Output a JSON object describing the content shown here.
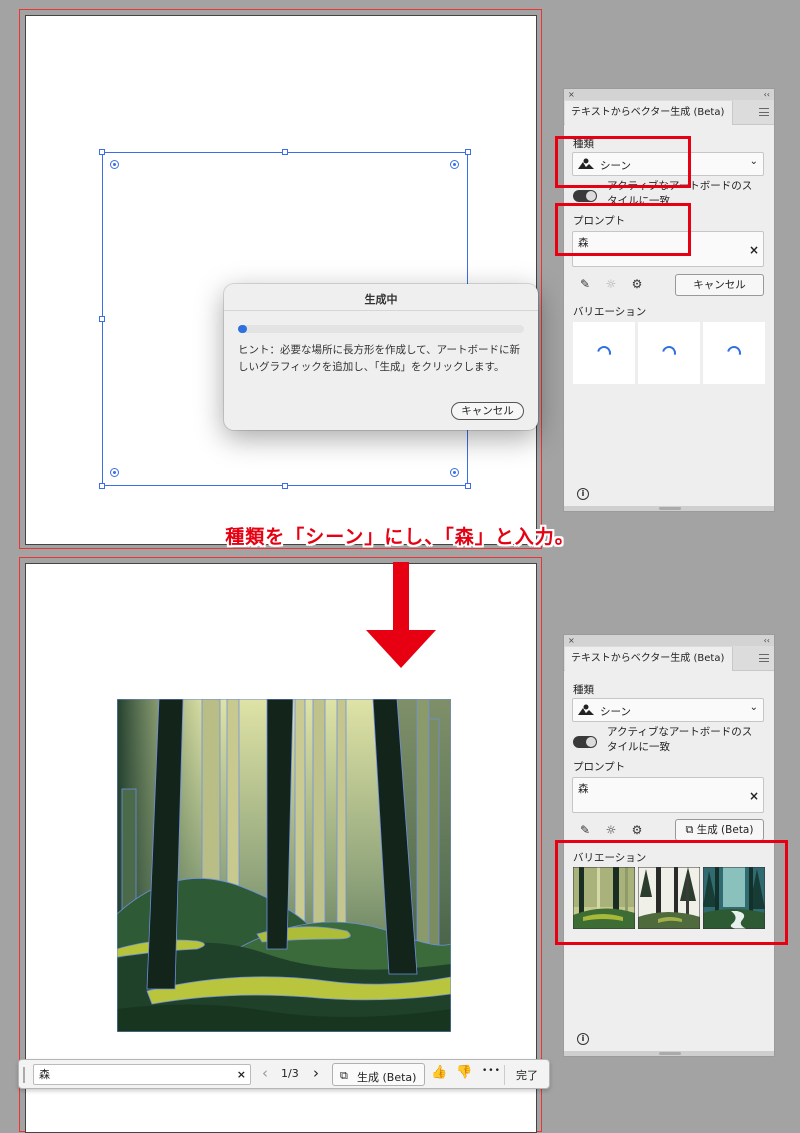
{
  "top": {
    "dialog": {
      "title": "生成中",
      "progress_fraction": 0.03,
      "hint": "ヒント：必要な場所に長方形を作成して、アートボードに新しいグラフィックを追加し、「生成」をクリックします。",
      "cancel_label": "キャンセル"
    },
    "panel": {
      "close_glyph": "×",
      "collapse_glyph": "‹‹",
      "tab_title": "テキストからベクター生成 (Beta)",
      "type_label": "種類",
      "type_value": "シーン",
      "toggle_label": "アクティブなアートボードのスタイルに一致",
      "prompt_label": "プロンプト",
      "prompt_value": "森",
      "clear_glyph": "×",
      "action_label": "キャンセル",
      "variations_label": "バリエーション",
      "info_glyph": "i"
    }
  },
  "caption": "種類を「シーン」にし、「森」と入力。",
  "bottom": {
    "panel": {
      "close_glyph": "×",
      "collapse_glyph": "‹‹",
      "tab_title": "テキストからベクター生成 (Beta)",
      "type_label": "種類",
      "type_value": "シーン",
      "toggle_label": "アクティブなアートボードのスタイルに一致",
      "prompt_label": "プロンプト",
      "prompt_value": "森",
      "clear_glyph": "×",
      "action_label": "生成 (Beta)",
      "variations_label": "バリエーション",
      "info_glyph": "i"
    },
    "context_bar": {
      "prompt_value": "森",
      "clear_glyph": "×",
      "prev_glyph": "‹",
      "page_indicator": "1/3",
      "next_glyph": "›",
      "generate_label": "生成 (Beta)",
      "more_glyph": "•••",
      "done_label": "完了"
    }
  },
  "colors": {
    "accent_blue": "#2f6fe0",
    "highlight_red": "#e60012",
    "canvas_gray": "#a3a3a3"
  },
  "icons": [
    "scene-type-icon",
    "chevron-down-icon",
    "style-reference-icon",
    "lightbulb-icon",
    "gear-icon",
    "loading-spinner-icon",
    "info-icon",
    "arrow-down-icon",
    "generate-icon",
    "thumbs-up-icon",
    "thumbs-down-icon",
    "more-icon"
  ]
}
